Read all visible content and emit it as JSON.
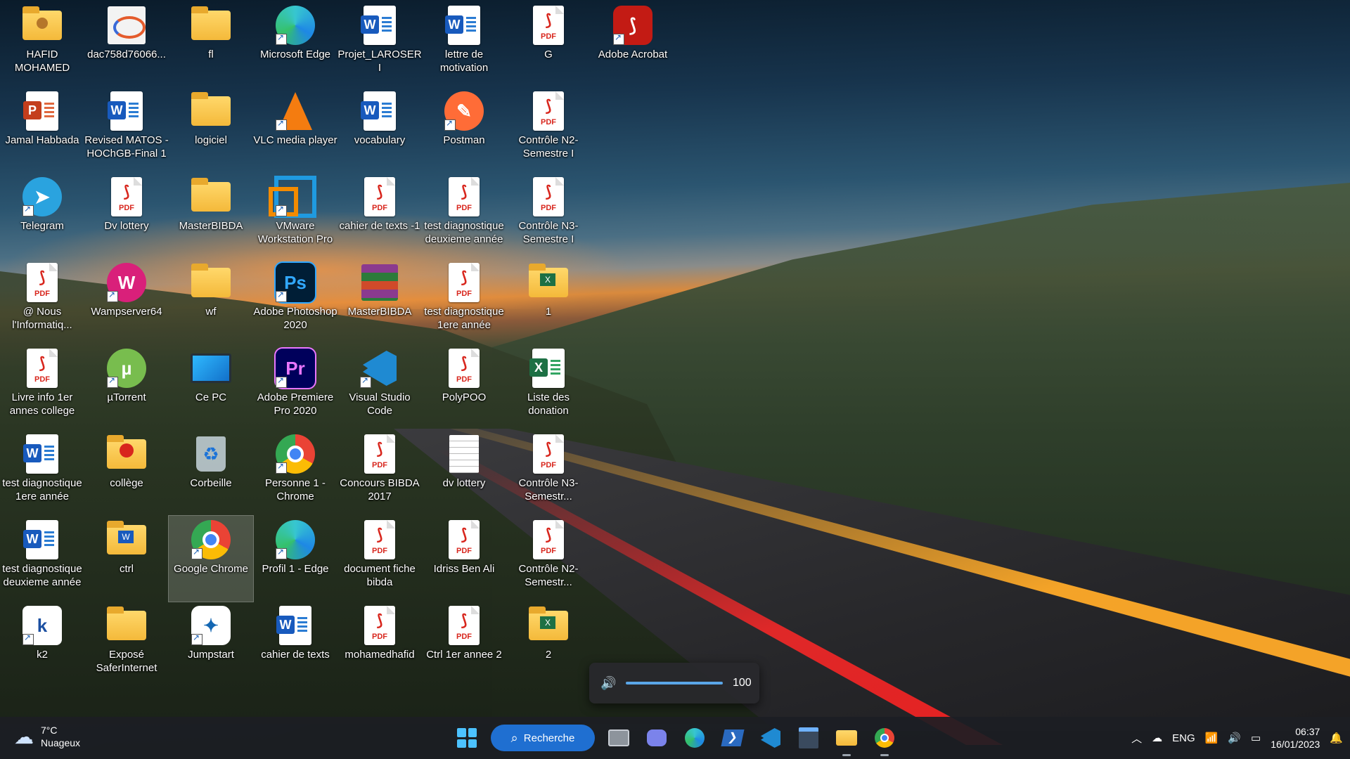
{
  "desktop": {
    "icons": [
      {
        "label": "HAFID MOHAMED",
        "type": "folder-user"
      },
      {
        "label": "dac758d76066...",
        "type": "image"
      },
      {
        "label": "fl",
        "type": "folder"
      },
      {
        "label": "Microsoft Edge",
        "type": "edge"
      },
      {
        "label": "Projet_LAROSERI",
        "type": "word"
      },
      {
        "label": "lettre de motivation",
        "type": "word"
      },
      {
        "label": "G",
        "type": "pdf"
      },
      {
        "label": "Adobe Acrobat",
        "type": "acrobat"
      },
      {
        "label": "Jamal Habbada",
        "type": "powerpoint"
      },
      {
        "label": "Revised MATOS -HOChGB-Final 1",
        "type": "word"
      },
      {
        "label": "logiciel",
        "type": "folder"
      },
      {
        "label": "VLC media player",
        "type": "vlc"
      },
      {
        "label": "vocabulary",
        "type": "word"
      },
      {
        "label": "Postman",
        "type": "postman"
      },
      {
        "label": "Contrôle N2-Semestre I",
        "type": "pdf"
      },
      {
        "label": "Telegram",
        "type": "telegram"
      },
      {
        "label": "Dv lottery",
        "type": "pdf"
      },
      {
        "label": "MasterBIBDA",
        "type": "folder"
      },
      {
        "label": "VMware Workstation Pro",
        "type": "vmware"
      },
      {
        "label": "cahier de texts -1",
        "type": "pdf"
      },
      {
        "label": "test diagnostique deuxieme année",
        "type": "pdf"
      },
      {
        "label": "Contrôle N3-Semestre I",
        "type": "pdf"
      },
      {
        "label": "@ Nous l'Informatiq...",
        "type": "pdf"
      },
      {
        "label": "Wampserver64",
        "type": "wamp"
      },
      {
        "label": "wf",
        "type": "folder"
      },
      {
        "label": "Adobe Photoshop 2020",
        "type": "photoshop"
      },
      {
        "label": "MasterBIBDA",
        "type": "winrar"
      },
      {
        "label": "test diagnostique 1ere année",
        "type": "pdf"
      },
      {
        "label": "1",
        "type": "folder-excel"
      },
      {
        "label": "Livre info 1er annes college",
        "type": "pdf"
      },
      {
        "label": "µTorrent",
        "type": "utorrent"
      },
      {
        "label": "Ce PC",
        "type": "pc"
      },
      {
        "label": "Adobe Premiere Pro 2020",
        "type": "premiere"
      },
      {
        "label": "Visual Studio Code",
        "type": "vscode"
      },
      {
        "label": "PolyPOO",
        "type": "pdf"
      },
      {
        "label": "Liste des donation",
        "type": "excel"
      },
      {
        "label": "test diagnostique 1ere année",
        "type": "word"
      },
      {
        "label": "collège",
        "type": "folder-pdf"
      },
      {
        "label": "Corbeille",
        "type": "recycle"
      },
      {
        "label": "Personne 1 - Chrome",
        "type": "chrome-profile"
      },
      {
        "label": "Concours BIBDA 2017",
        "type": "pdf"
      },
      {
        "label": "dv lottery",
        "type": "text"
      },
      {
        "label": "Contrôle N3-Semestr...",
        "type": "pdf"
      },
      {
        "label": "test diagnostique deuxieme année",
        "type": "word"
      },
      {
        "label": "ctrl",
        "type": "folder-word"
      },
      {
        "label": "Google Chrome",
        "type": "chrome"
      },
      {
        "label": "Profil 1 - Edge",
        "type": "edge-profile"
      },
      {
        "label": "document fiche bibda",
        "type": "pdf"
      },
      {
        "label": "Idriss Ben Ali",
        "type": "pdf"
      },
      {
        "label": "Contrôle N2-Semestr...",
        "type": "pdf"
      },
      {
        "label": "k2",
        "type": "k2"
      },
      {
        "label": "Exposé SaferInternet",
        "type": "folder"
      },
      {
        "label": "Jumpstart",
        "type": "jumpstart"
      },
      {
        "label": "cahier de texts",
        "type": "word"
      },
      {
        "label": "mohamedhafid",
        "type": "pdf"
      },
      {
        "label": "Ctrl 1er annee 2",
        "type": "pdf"
      },
      {
        "label": "2",
        "type": "folder-excel"
      }
    ]
  },
  "volume_flyout": {
    "icon": "speaker-icon",
    "value": "100",
    "level_percent": 100
  },
  "taskbar": {
    "weather": {
      "temp": "7°C",
      "condition": "Nuageux",
      "icon": "cloud-icon"
    },
    "search_label": "Recherche",
    "apps": [
      {
        "name": "task-view",
        "glyph": "▣"
      },
      {
        "name": "teams-chat",
        "glyph": "▶"
      },
      {
        "name": "edge",
        "glyph": "◉"
      },
      {
        "name": "powershell",
        "glyph": "❯"
      },
      {
        "name": "vscode",
        "glyph": "⟩"
      },
      {
        "name": "terminal",
        "glyph": "▤"
      },
      {
        "name": "file-explorer",
        "glyph": "📁"
      },
      {
        "name": "chrome",
        "glyph": "◎"
      }
    ],
    "tray": {
      "language": "ENG",
      "time": "06:37",
      "date": "16/01/2023"
    }
  }
}
